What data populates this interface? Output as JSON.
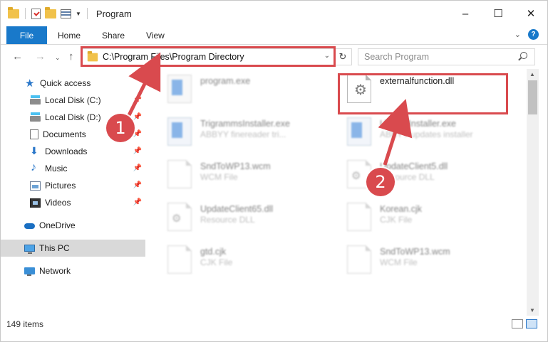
{
  "window": {
    "title": "Program",
    "minimize": "–",
    "maximize": "☐",
    "close": "✕"
  },
  "ribbon": {
    "tabs": [
      "File",
      "Home",
      "Share",
      "View"
    ],
    "collapse_icon": "chevron-down-icon",
    "help": "?"
  },
  "nav": {
    "address": "C:\\Program Files\\Program Directory",
    "search_placeholder": "Search Program"
  },
  "sidebar": {
    "items": [
      {
        "label": "Quick access",
        "icon": "star-icon"
      },
      {
        "label": "Local Disk (C:)",
        "icon": "drive-icon"
      },
      {
        "label": "Local Disk (D:)",
        "icon": "drive-icon"
      },
      {
        "label": "Documents",
        "icon": "documents-icon"
      },
      {
        "label": "Downloads",
        "icon": "downloads-icon"
      },
      {
        "label": "Music",
        "icon": "music-icon"
      },
      {
        "label": "Pictures",
        "icon": "pictures-icon"
      },
      {
        "label": "Videos",
        "icon": "videos-icon"
      },
      {
        "label": "OneDrive",
        "icon": "onedrive-icon"
      },
      {
        "label": "This PC",
        "icon": "pc-icon"
      },
      {
        "label": "Network",
        "icon": "network-icon"
      }
    ],
    "selected": "This PC"
  },
  "files": [
    {
      "name": "program.exe",
      "type": ""
    },
    {
      "name": "externalfunction.dll",
      "type": ""
    },
    {
      "name": "TrigrammsInstaller.exe",
      "type": "ABBYY finereader tri..."
    },
    {
      "name": "UpdateInstaller.exe",
      "type": "ABBYY updates installer"
    },
    {
      "name": "SndToWP13.wcm",
      "type": "WCM File"
    },
    {
      "name": "UpdateClient5.dll",
      "type": "Resource DLL"
    },
    {
      "name": "UpdateClient65.dll",
      "type": "Resource DLL"
    },
    {
      "name": "Korean.cjk",
      "type": "CJK File"
    },
    {
      "name": "gtd.cjk",
      "type": "CJK File"
    },
    {
      "name": "SndToWP13.wcm",
      "type": "WCM File"
    }
  ],
  "status": {
    "count": "149 items"
  },
  "annotations": {
    "step1": "1",
    "step2": "2",
    "color": "#d94a4e"
  }
}
